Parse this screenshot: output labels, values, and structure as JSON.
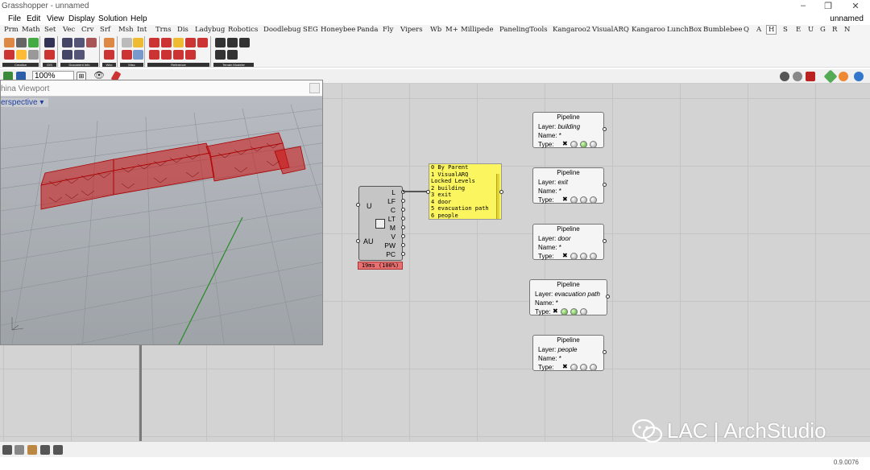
{
  "window": {
    "title": "Grasshopper - unnamed",
    "doc_name": "unnamed"
  },
  "menu": [
    "File",
    "Edit",
    "View",
    "Display",
    "Solution",
    "Help"
  ],
  "tabs": [
    "Prm",
    "Math",
    "Set",
    "Vec",
    "Crv",
    "Srf",
    "Msh",
    "Int",
    "Trns",
    "Dis",
    "Ladybug",
    "Robotics",
    "Doodlebug",
    "SEG",
    "Honeybee",
    "Panda",
    "Fly",
    "Vipers",
    "Wb",
    "M+",
    "Millipede",
    "PanelingTools",
    "Kangaroo2",
    "VisualARQ",
    "Kangaroo",
    "LunchBox",
    "Bumblebee",
    "Q",
    "A",
    "H",
    "S",
    "E",
    "U",
    "G",
    "R",
    "N"
  ],
  "active_tab": "H",
  "ribbon_groups": [
    "Creation",
    "GIS",
    "Document Info",
    "Wbc",
    "Misc",
    "Reference",
    "Terrain Modeler"
  ],
  "toolbar": {
    "zoom": "100%"
  },
  "viewport": {
    "title": "hina Viewport",
    "view_name": "erspective"
  },
  "component": {
    "inputs": [
      "U",
      "AU"
    ],
    "outputs": [
      "L",
      "LF",
      "C",
      "LT",
      "M",
      "V",
      "PW",
      "PC"
    ],
    "timer": "19ms (100%)"
  },
  "panel": {
    "lines": [
      "0 By Parent",
      "1 VisualARQ",
      "  Locked Levels",
      "2 building",
      "3 exit",
      "4 door",
      "5 evacuation path",
      "6 people"
    ]
  },
  "pipelines": [
    {
      "title": "Pipeline",
      "layer_label": "Layer:",
      "layer": "building",
      "name_label": "Name:",
      "name": "*",
      "type_label": "Type:"
    },
    {
      "title": "Pipeline",
      "layer_label": "Layer:",
      "layer": "exit",
      "name_label": "Name:",
      "name": "*",
      "type_label": "Type:"
    },
    {
      "title": "Pipeline",
      "layer_label": "Layer:",
      "layer": "door",
      "name_label": "Name:",
      "name": "*",
      "type_label": "Type:"
    },
    {
      "title": "Pipeline",
      "layer_label": "Layer:",
      "layer": "evacuation path",
      "name_label": "Name:",
      "name": "*",
      "type_label": "Type:"
    },
    {
      "title": "Pipeline",
      "layer_label": "Layer:",
      "layer": "people",
      "name_label": "Name:",
      "name": "*",
      "type_label": "Type:"
    }
  ],
  "status": {
    "version": "0.9.0076"
  },
  "watermark": {
    "text": "LAC | ArchStudio"
  },
  "colors": {
    "panel_yellow": "#fbf560",
    "timer_red": "#e87070",
    "model_red": "#cc1010",
    "canvas": "#d3d3d3"
  }
}
